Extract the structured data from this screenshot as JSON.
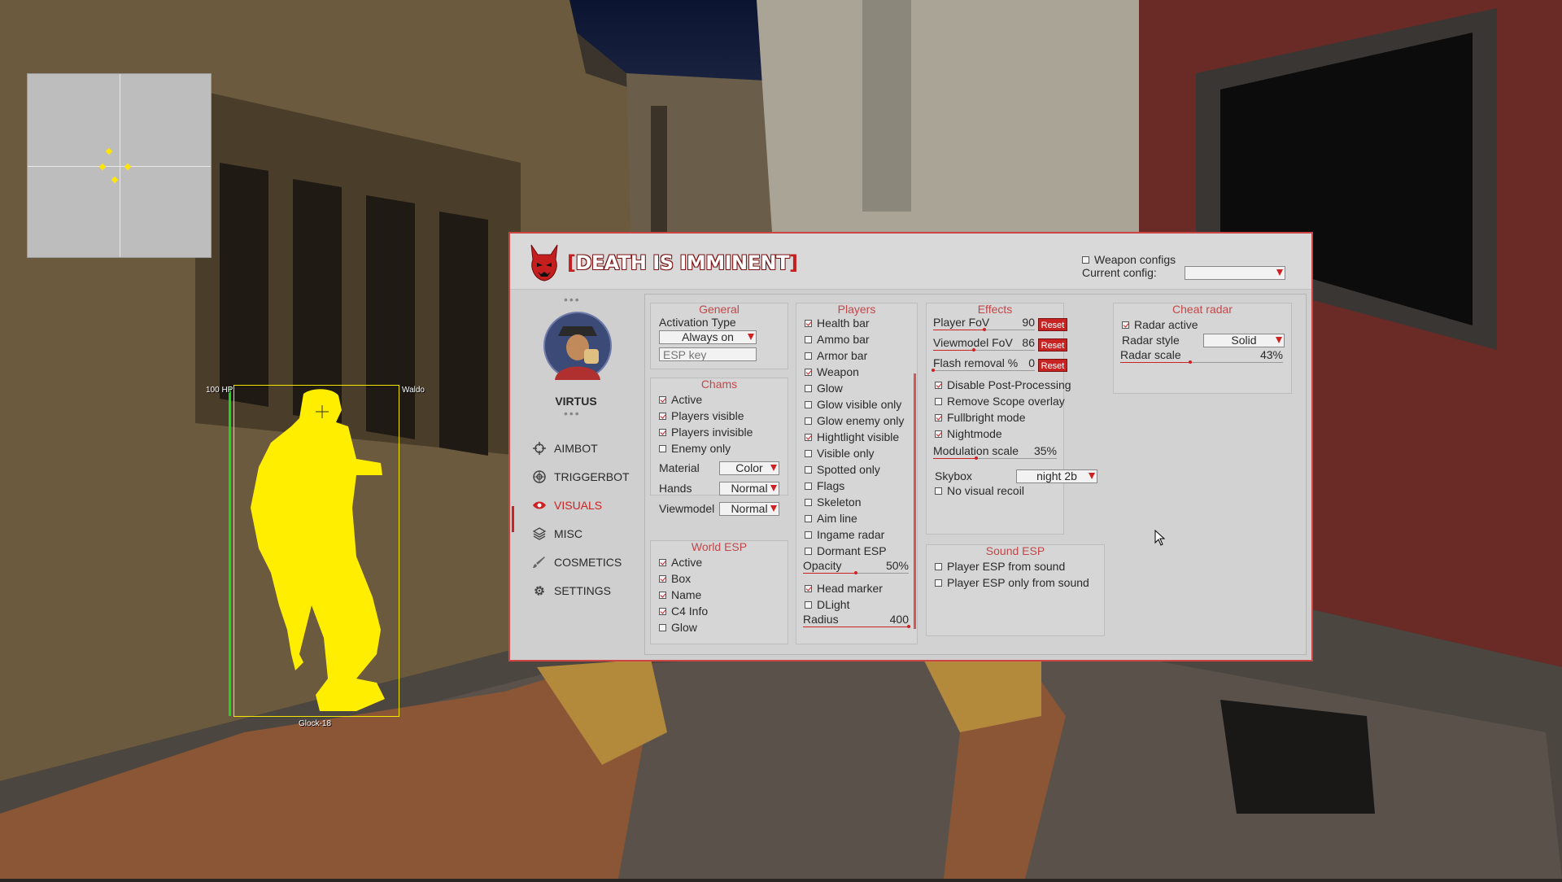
{
  "hud": {
    "hp_label": "100 HP",
    "player_name": "Waldo",
    "weapon": "Glock-18",
    "health_fraction": 1.0
  },
  "menu": {
    "title": "DEATH IS IMMINENT",
    "title_bracket_open": "[",
    "title_bracket_close": "]",
    "weapon_configs_label": "Weapon configs",
    "weapon_configs_checked": false,
    "current_config_label": "Current config:",
    "current_config_value": "",
    "username": "VIRTUS",
    "nav": [
      {
        "label": "AIMBOT",
        "icon": "crosshair-icon",
        "active": false
      },
      {
        "label": "TRIGGERBOT",
        "icon": "target-icon",
        "active": false
      },
      {
        "label": "VISUALS",
        "icon": "eye-icon",
        "active": true
      },
      {
        "label": "MISC",
        "icon": "layers-icon",
        "active": false
      },
      {
        "label": "COSMETICS",
        "icon": "brush-icon",
        "active": false
      },
      {
        "label": "SETTINGS",
        "icon": "gear-icon",
        "active": false
      }
    ],
    "general": {
      "title": "General",
      "activation_type_label": "Activation Type",
      "activation_type_value": "Always on",
      "esp_key_placeholder": "ESP key"
    },
    "chams": {
      "title": "Chams",
      "checks": [
        {
          "label": "Active",
          "checked": true
        },
        {
          "label": "Players visible",
          "checked": true
        },
        {
          "label": "Players invisible",
          "checked": true
        },
        {
          "label": "Enemy only",
          "checked": false
        }
      ],
      "material_label": "Material",
      "material_value": "Color",
      "hands_label": "Hands",
      "hands_value": "Normal",
      "viewmodel_label": "Viewmodel",
      "viewmodel_value": "Normal"
    },
    "world_esp": {
      "title": "World ESP",
      "checks": [
        {
          "label": "Active",
          "checked": true
        },
        {
          "label": "Box",
          "checked": true
        },
        {
          "label": "Name",
          "checked": true
        },
        {
          "label": "C4 Info",
          "checked": true
        },
        {
          "label": "Glow",
          "checked": false
        }
      ]
    },
    "players": {
      "title": "Players",
      "checks": [
        {
          "label": "Health bar",
          "checked": true
        },
        {
          "label": "Ammo bar",
          "checked": false
        },
        {
          "label": "Armor bar",
          "checked": false
        },
        {
          "label": "Weapon",
          "checked": true
        },
        {
          "label": "Glow",
          "checked": false
        },
        {
          "label": "Glow visible only",
          "checked": false
        },
        {
          "label": "Glow enemy only",
          "checked": false
        },
        {
          "label": "Hightlight visible",
          "checked": true
        },
        {
          "label": "Visible only",
          "checked": false
        },
        {
          "label": "Spotted only",
          "checked": false
        },
        {
          "label": "Flags",
          "checked": false
        },
        {
          "label": "Skeleton",
          "checked": false
        },
        {
          "label": "Aim line",
          "checked": false
        },
        {
          "label": "Ingame radar",
          "checked": false
        },
        {
          "label": "Dormant ESP",
          "checked": false
        }
      ],
      "opacity_label": "Opacity",
      "opacity_value": "50%",
      "opacity_fraction": 0.5,
      "checks2": [
        {
          "label": "Head marker",
          "checked": true
        },
        {
          "label": "DLight",
          "checked": false
        }
      ],
      "radius_label": "Radius",
      "radius_value": "400",
      "radius_fraction": 1.0
    },
    "effects": {
      "title": "Effects",
      "sliders": [
        {
          "label": "Player FoV",
          "value": "90",
          "fraction": 0.5,
          "reset": "Reset"
        },
        {
          "label": "Viewmodel FoV",
          "value": "86",
          "fraction": 0.4,
          "reset": "Reset"
        },
        {
          "label": "Flash removal %",
          "value": "0",
          "fraction": 0.0,
          "reset": "Reset"
        }
      ],
      "checks": [
        {
          "label": "Disable Post-Processing",
          "checked": true
        },
        {
          "label": "Remove Scope overlay",
          "checked": false
        },
        {
          "label": "Fullbright mode",
          "checked": true
        },
        {
          "label": "Nightmode",
          "checked": true
        }
      ],
      "modulation_label": "Modulation scale",
      "modulation_value": "35%",
      "modulation_fraction": 0.35,
      "skybox_label": "Skybox",
      "skybox_value": "night 2b",
      "no_visual_recoil_label": "No visual recoil",
      "no_visual_recoil_checked": false
    },
    "sound_esp": {
      "title": "Sound ESP",
      "checks": [
        {
          "label": "Player ESP from sound",
          "checked": false
        },
        {
          "label": "Player ESP only from sound",
          "checked": false
        }
      ]
    },
    "cheat_radar": {
      "title": "Cheat radar",
      "radar_active_label": "Radar active",
      "radar_active_checked": true,
      "radar_style_label": "Radar style",
      "radar_style_value": "Solid",
      "radar_scale_label": "Radar scale",
      "radar_scale_value": "43%",
      "radar_scale_fraction": 0.43
    }
  },
  "colors": {
    "accent": "#c22222",
    "esp_box": "#f2e600",
    "health": "#1bd81b",
    "chams": "#ffee00"
  }
}
